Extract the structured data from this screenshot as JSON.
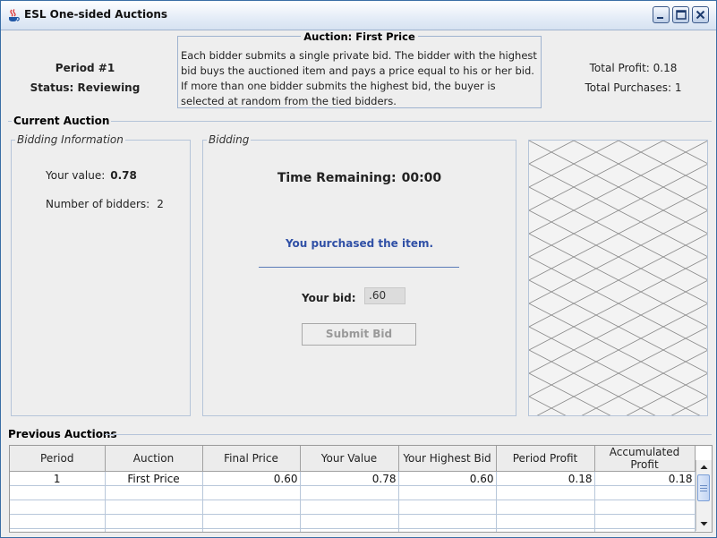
{
  "window": {
    "title": "ESL One-sided Auctions",
    "controls": [
      "minimize-icon",
      "maximize-icon",
      "close-icon"
    ]
  },
  "header": {
    "period": "Period #1",
    "status": "Status: Reviewing",
    "auction_title": "Auction: First Price",
    "auction_description": "Each bidder submits a single private bid. The bidder with the highest bid buys the auctioned item and pays a price equal to his or her bid. If more than one bidder submits the highest bid, the buyer is selected at random from the tied bidders.",
    "total_profit": "Total Profit: 0.18",
    "total_purchases": "Total Purchases: 1"
  },
  "current_auction": {
    "title": "Current Auction",
    "bidding_info": {
      "title": "Bidding Information",
      "your_value_label": "Your value:",
      "your_value": "0.78",
      "num_bidders_label": "Number of bidders:",
      "num_bidders": "2"
    },
    "bidding": {
      "title": "Bidding",
      "time_label": "Time Remaining:",
      "time_value": "00:00",
      "result_message": "You purchased the item.",
      "bid_label": "Your bid:",
      "bid_value": ".60",
      "submit_label": "Submit Bid"
    }
  },
  "previous_auctions": {
    "title": "Previous Auctions",
    "columns": [
      "Period",
      "Auction",
      "Final Price",
      "Your Value",
      "Your Highest Bid",
      "Period Profit",
      "Accumulated Profit"
    ],
    "rows": [
      [
        "1",
        "First Price",
        "0.60",
        "0.78",
        "0.60",
        "0.18",
        "0.18"
      ]
    ]
  },
  "colors": {
    "accent_text": "#3050a6",
    "title_bar_border": "#3a6ea5",
    "group_border": "#b5c4d9"
  }
}
